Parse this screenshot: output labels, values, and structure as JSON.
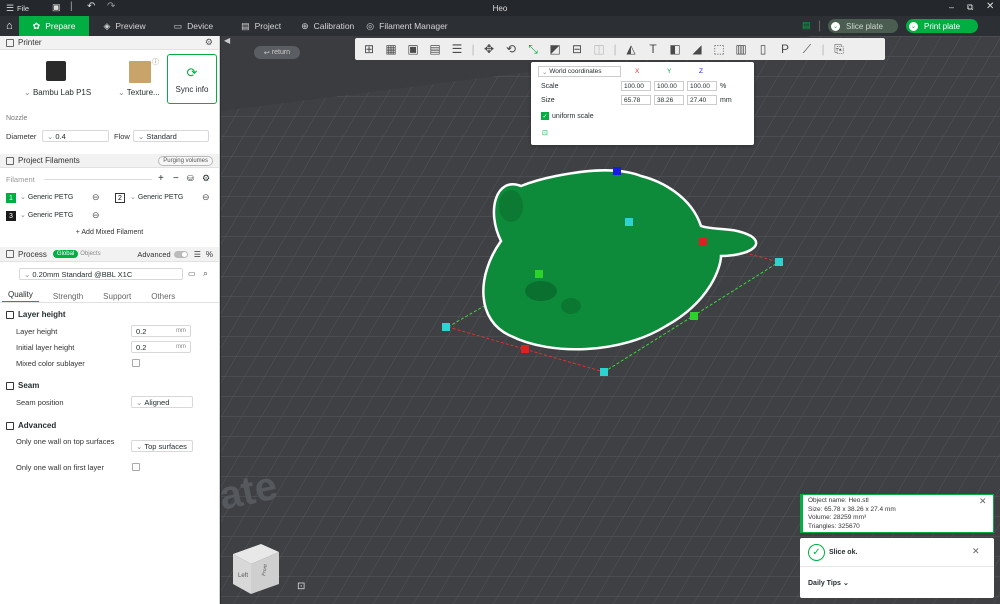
{
  "window": {
    "title": "Heo",
    "menu_file": "File"
  },
  "nav": {
    "tabs": [
      {
        "label": "Prepare",
        "icon": "home-icon"
      },
      {
        "label": "Preview",
        "icon": "preview-icon"
      },
      {
        "label": "Device",
        "icon": "device-icon"
      },
      {
        "label": "Project",
        "icon": "project-icon"
      },
      {
        "label": "Calibration",
        "icon": "calibration-icon"
      },
      {
        "label": "Filament Manager",
        "icon": "filament-manager-icon"
      }
    ],
    "slice_label": "Slice plate",
    "print_label": "Print plate"
  },
  "printer": {
    "header": "Printer",
    "printer_name": "Bambu Lab P1S",
    "plate_name": "Texture...",
    "sync_label": "Sync info",
    "nozzle_title": "Nozzle",
    "diameter_label": "Diameter",
    "diameter_value": "0.4",
    "flow_label": "Flow",
    "flow_value": "Standard"
  },
  "filaments": {
    "header": "Project Filaments",
    "purging_label": "Purging volumes",
    "filament_label": "Filament",
    "items": [
      {
        "index": "1",
        "name": "Generic PETG",
        "color": "#00ae42"
      },
      {
        "index": "2",
        "name": "Generic PETG",
        "color": "#ffffff"
      },
      {
        "index": "3",
        "name": "Generic PETG",
        "color": "#1a1a1a"
      }
    ],
    "add_mixed": "+ Add Mixed Filament"
  },
  "process": {
    "header": "Process",
    "global_label": "Global",
    "objects_label": "Objects",
    "advanced_label": "Advanced",
    "profile": "0.20mm Standard @BBL X1C",
    "tabs": [
      "Quality",
      "Strength",
      "Support",
      "Others"
    ],
    "layer_height_title": "Layer height",
    "layer_height_label": "Layer height",
    "layer_height_value": "0.2",
    "initial_layer_label": "Initial layer height",
    "initial_layer_value": "0.2",
    "unit_mm": "mm",
    "mixed_color_label": "Mixed color sublayer",
    "seam_title": "Seam",
    "seam_position_label": "Seam position",
    "seam_position_value": "Aligned",
    "advanced_title": "Advanced",
    "one_wall_top_label": "Only one wall on top surfaces",
    "one_wall_top_value": "Top surfaces",
    "one_wall_first_label": "Only one wall on first layer"
  },
  "viewport": {
    "return_label": "return",
    "plate_text": "late",
    "cube_left": "Left",
    "cube_front": "Front"
  },
  "scale_panel": {
    "coord_mode": "World coordinates",
    "x_label": "X",
    "y_label": "Y",
    "z_label": "Z",
    "scale_label": "Scale",
    "scale_x": "100.00",
    "scale_y": "100.00",
    "scale_z": "100.00",
    "scale_unit": "%",
    "size_label": "Size",
    "size_x": "65.78",
    "size_y": "38.26",
    "size_z": "27.40",
    "size_unit": "mm",
    "uniform_label": "uniform scale"
  },
  "object_info": {
    "name": "Object name: Heo.stl",
    "size": "Size: 65.78 x 38.26 x 27.4 mm",
    "volume": "Volume: 28259 mm³",
    "triangles": "Triangles: 325670"
  },
  "slice_status": {
    "message": "Slice ok.",
    "tips_label": "Daily Tips"
  },
  "colors": {
    "accent": "#00ae42",
    "model": "#0f8a3c",
    "bed": "#3a3c40"
  }
}
